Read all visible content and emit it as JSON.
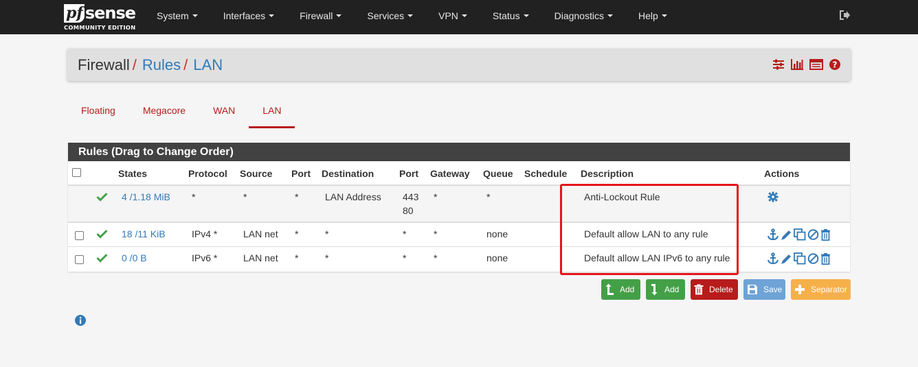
{
  "brand": {
    "logo_pf": "pf",
    "logo_sense": "sense",
    "edition": "COMMUNITY EDITION"
  },
  "nav": {
    "items": [
      {
        "label": "System"
      },
      {
        "label": "Interfaces"
      },
      {
        "label": "Firewall"
      },
      {
        "label": "Services"
      },
      {
        "label": "VPN"
      },
      {
        "label": "Status"
      },
      {
        "label": "Diagnostics"
      },
      {
        "label": "Help"
      }
    ],
    "logout_icon": "sign-out-icon"
  },
  "breadcrumb": {
    "firewall": "Firewall",
    "rules": "Rules",
    "lan": "LAN",
    "separator": "/",
    "icons": [
      "sliders-icon",
      "bar-chart-icon",
      "table-icon",
      "question-circle-icon"
    ],
    "icon_color": "#b71c1c"
  },
  "tabs": [
    {
      "label": "Floating",
      "active": false
    },
    {
      "label": "Megacore",
      "active": false
    },
    {
      "label": "WAN",
      "active": false
    },
    {
      "label": "LAN",
      "active": true
    }
  ],
  "rules_panel": {
    "title": "Rules (Drag to Change Order)",
    "columns": {
      "states": "States",
      "protocol": "Protocol",
      "source": "Source",
      "port": "Port",
      "destination": "Destination",
      "dport": "Port",
      "gateway": "Gateway",
      "queue": "Queue",
      "schedule": "Schedule",
      "description": "Description",
      "actions": "Actions"
    },
    "rows": [
      {
        "states": "4 /1.18 MiB",
        "protocol": "*",
        "source": "*",
        "port": "*",
        "destination": "LAN Address",
        "dport_line1": "443",
        "dport_line2": "80",
        "gateway": "*",
        "queue": "*",
        "schedule": "",
        "description": "Anti-Lockout Rule"
      },
      {
        "states": "18 /11 KiB",
        "protocol": "IPv4 *",
        "source": "LAN net",
        "port": "*",
        "destination": "*",
        "dport": "*",
        "gateway": "*",
        "queue": "none",
        "schedule": "",
        "description": "Default allow LAN to any rule"
      },
      {
        "states": "0 /0 B",
        "protocol": "IPv6 *",
        "source": "LAN net",
        "port": "*",
        "destination": "*",
        "dport": "*",
        "gateway": "*",
        "queue": "none",
        "schedule": "",
        "description": "Default allow LAN IPv6 to any rule"
      }
    ]
  },
  "buttons": {
    "add_top": "Add",
    "add_bottom": "Add",
    "delete": "Delete",
    "save": "Save",
    "separator": "Separator"
  },
  "colors": {
    "navbar": "#212121",
    "accent_red": "#b71c1c",
    "link_blue": "#337ab7",
    "success_green": "#43a047",
    "highlight_red": "#e6141c"
  }
}
